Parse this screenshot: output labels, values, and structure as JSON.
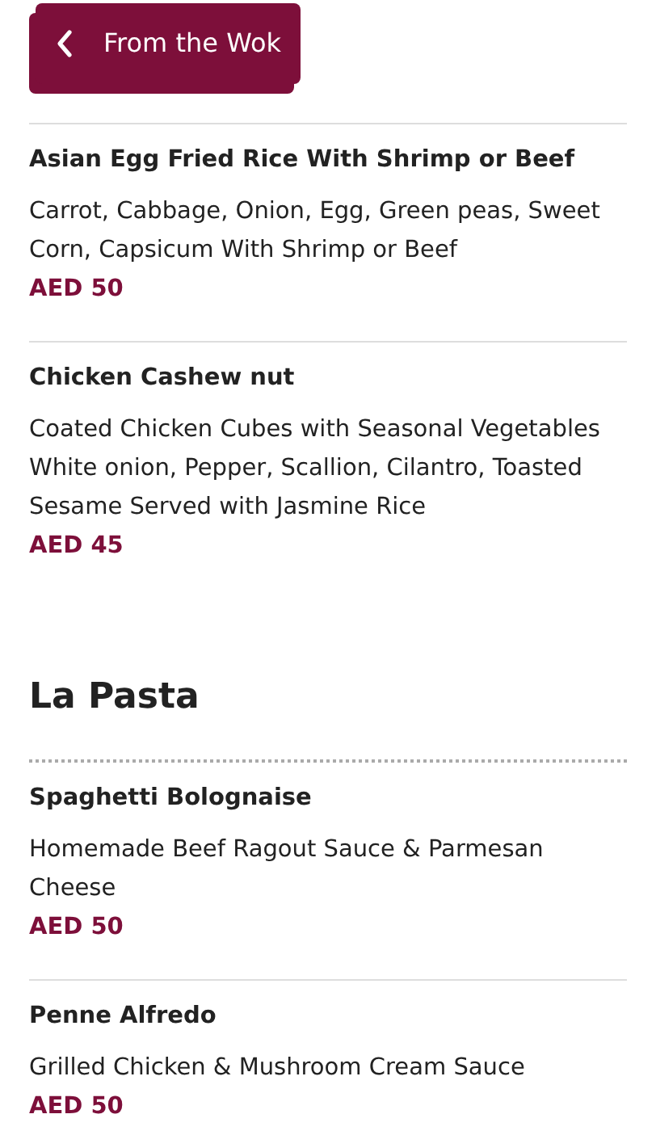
{
  "header": {
    "back_label": "From the Wok"
  },
  "sections": [
    {
      "items": [
        {
          "name": "Asian Egg Fried Rice With Shrimp or Beef",
          "description": "Carrot, Cabbage, Onion, Egg, Green peas, Sweet Corn, Capsicum With Shrimp or Beef",
          "price": "AED 50"
        },
        {
          "name": "Chicken Cashew nut",
          "description": "Coated Chicken Cubes with Seasonal Vegetables White onion, Pepper, Scallion, Cilantro, Toasted Sesame Served with Jasmine Rice",
          "price": "AED 45"
        }
      ]
    },
    {
      "title": "La Pasta",
      "items": [
        {
          "name": "Spaghetti Bolognaise",
          "description": "Homemade Beef Ragout Sauce & Parmesan Cheese",
          "price": "AED 50"
        },
        {
          "name": "Penne Alfredo",
          "description": "Grilled Chicken & Mushroom Cream Sauce",
          "price": "AED 50"
        }
      ]
    }
  ]
}
